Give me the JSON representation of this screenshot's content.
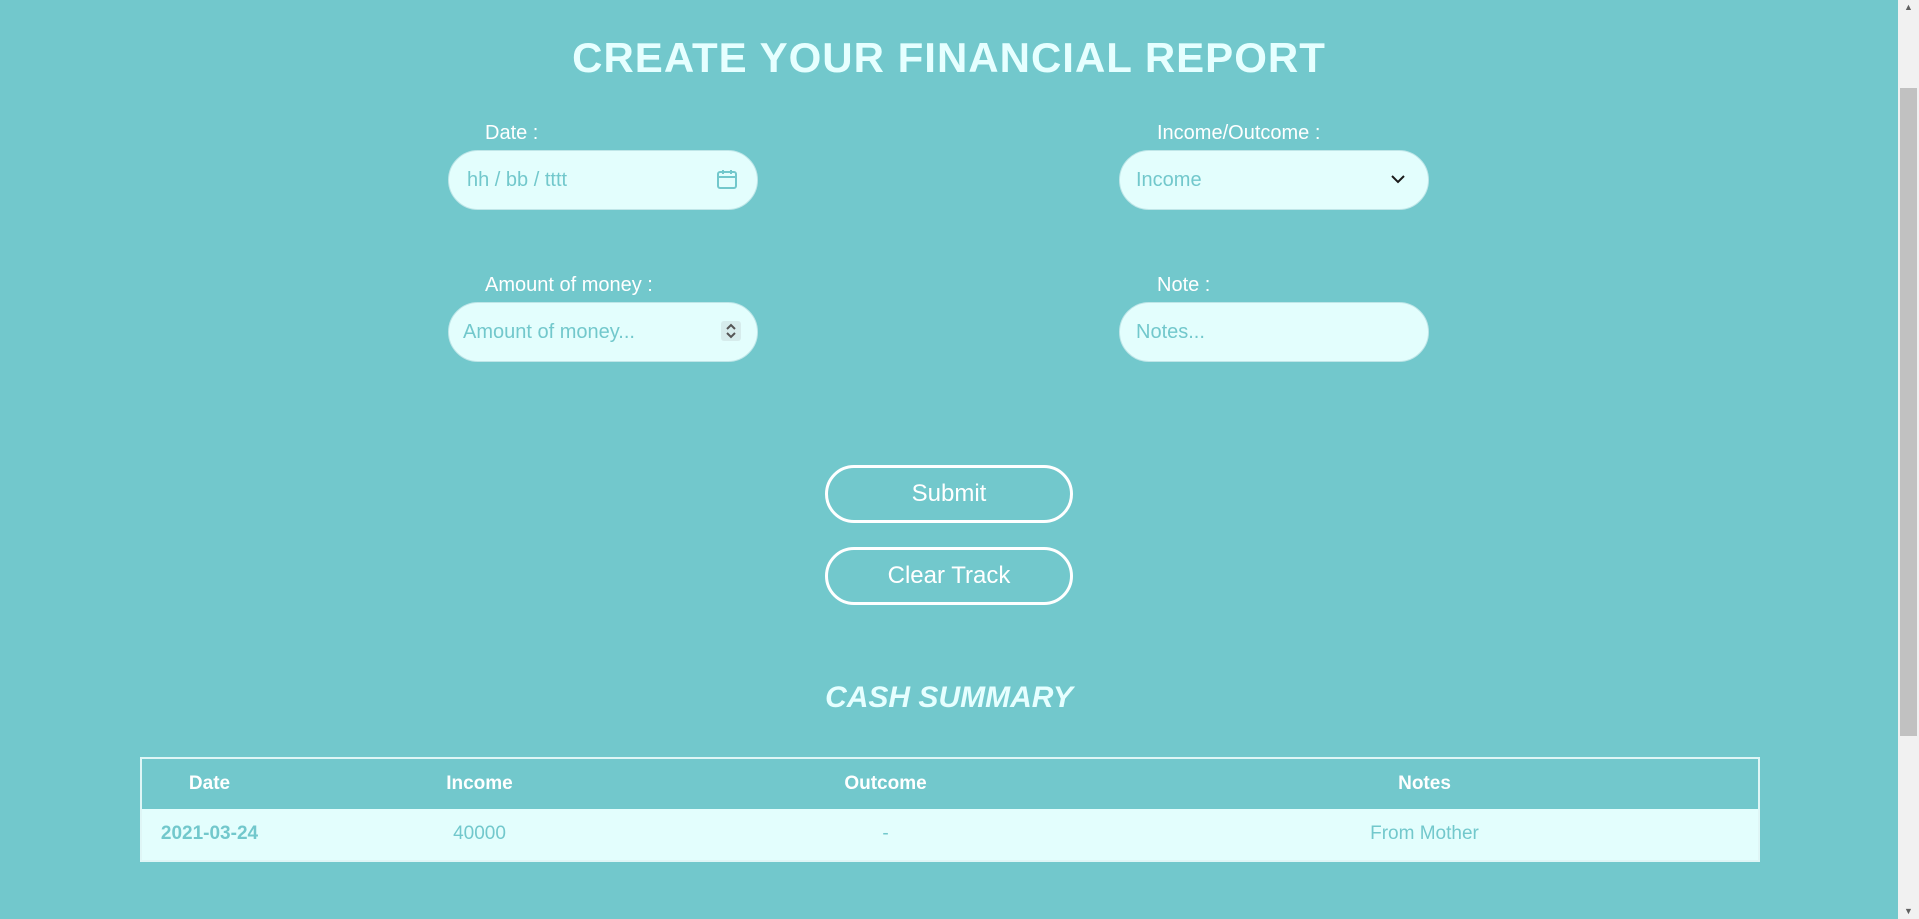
{
  "header": {
    "title": "CREATE YOUR FINANCIAL REPORT"
  },
  "form": {
    "date": {
      "label": "Date :",
      "placeholder": "hh / bb / tttt",
      "icon": "calendar-icon"
    },
    "type": {
      "label": "Income/Outcome :",
      "selected": "Income",
      "icon": "chevron-down-icon"
    },
    "amount": {
      "label": "Amount of money :",
      "placeholder": "Amount of money...",
      "icon": "spinner-icon"
    },
    "note": {
      "label": "Note :",
      "placeholder": "Notes..."
    }
  },
  "buttons": {
    "submit": "Submit",
    "clear": "Clear Track"
  },
  "summary": {
    "title": "CASH SUMMARY",
    "columns": [
      "Date",
      "Income",
      "Outcome",
      "Notes"
    ],
    "rows": [
      {
        "date": "2021-03-24",
        "income": "40000",
        "outcome": "-",
        "notes": "From Mother"
      }
    ]
  },
  "colors": {
    "background": "#72c8cc",
    "field": "#e3fefd",
    "text": "#ffffff"
  }
}
